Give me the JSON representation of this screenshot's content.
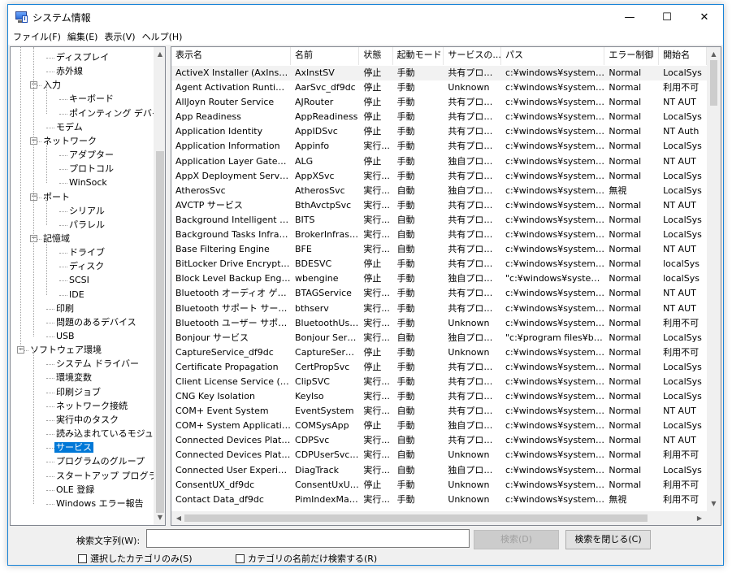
{
  "window": {
    "title": "システム情報"
  },
  "title_buttons": {
    "minimize": "—",
    "maximize": "☐",
    "close": "✕"
  },
  "menu": [
    "ファイル(F)",
    "編集(E)",
    "表示(V)",
    "ヘルプ(H)"
  ],
  "tree": [
    {
      "label": "ディスプレイ"
    },
    {
      "label": "赤外線"
    },
    {
      "label": "入力",
      "toggle": "−"
    },
    {
      "label": "キーボード"
    },
    {
      "label": "ポインティング デバイス"
    },
    {
      "label": "モデム"
    },
    {
      "label": "ネットワーク",
      "toggle": "−"
    },
    {
      "label": "アダプター"
    },
    {
      "label": "プロトコル"
    },
    {
      "label": "WinSock"
    },
    {
      "label": "ポート",
      "toggle": "−"
    },
    {
      "label": "シリアル"
    },
    {
      "label": "パラレル"
    },
    {
      "label": "記憶域",
      "toggle": "−"
    },
    {
      "label": "ドライブ"
    },
    {
      "label": "ディスク"
    },
    {
      "label": "SCSI"
    },
    {
      "label": "IDE"
    },
    {
      "label": "印刷"
    },
    {
      "label": "問題のあるデバイス"
    },
    {
      "label": "USB"
    },
    {
      "label": "ソフトウェア環境",
      "toggle": "−"
    },
    {
      "label": "システム ドライバー"
    },
    {
      "label": "環境変数"
    },
    {
      "label": "印刷ジョブ"
    },
    {
      "label": "ネットワーク接続"
    },
    {
      "label": "実行中のタスク"
    },
    {
      "label": "読み込まれているモジュール"
    },
    {
      "label": "サービス",
      "selected": true
    },
    {
      "label": "プログラムのグループ"
    },
    {
      "label": "スタートアップ プログラム"
    },
    {
      "label": "OLE 登録"
    },
    {
      "label": "Windows エラー報告"
    }
  ],
  "table": {
    "columns": [
      "表示名",
      "名前",
      "状態",
      "起動モード",
      "サービスの...",
      "パス",
      "エラー制御",
      "開始名"
    ],
    "rows": [
      [
        "ActiveX Installer (AxInstSV)",
        "AxInstSV",
        "停止",
        "手動",
        "共有プロセス",
        "c:¥windows¥system32...",
        "Normal",
        "LocalSys"
      ],
      [
        "Agent Activation Runtime_d...",
        "AarSvc_df9dc",
        "停止",
        "手動",
        "Unknown",
        "c:¥windows¥system32...",
        "Normal",
        "利用不可"
      ],
      [
        "AllJoyn Router Service",
        "AJRouter",
        "停止",
        "手動",
        "共有プロセス",
        "c:¥windows¥system32...",
        "Normal",
        "NT AUT"
      ],
      [
        "App Readiness",
        "AppReadiness",
        "停止",
        "手動",
        "共有プロセス",
        "c:¥windows¥system32...",
        "Normal",
        "LocalSys"
      ],
      [
        "Application Identity",
        "AppIDSvc",
        "停止",
        "手動",
        "共有プロセス",
        "c:¥windows¥system32...",
        "Normal",
        "NT Auth"
      ],
      [
        "Application Information",
        "Appinfo",
        "実行...",
        "手動",
        "共有プロセス",
        "c:¥windows¥system32...",
        "Normal",
        "LocalSys"
      ],
      [
        "Application Layer Gateway ...",
        "ALG",
        "停止",
        "手動",
        "独自プロセス",
        "c:¥windows¥system32...",
        "Normal",
        "NT AUT"
      ],
      [
        "AppX Deployment Service (...",
        "AppXSvc",
        "実行...",
        "手動",
        "共有プロセス",
        "c:¥windows¥system32...",
        "Normal",
        "LocalSys"
      ],
      [
        "AtherosSvc",
        "AtherosSvc",
        "実行...",
        "自動",
        "独自プロセス",
        "c:¥windows¥system32...",
        "無視",
        "LocalSys"
      ],
      [
        "AVCTP サービス",
        "BthAvctpSvc",
        "実行...",
        "手動",
        "共有プロセス",
        "c:¥windows¥system32...",
        "Normal",
        "NT AUT"
      ],
      [
        "Background Intelligent Tran...",
        "BITS",
        "実行...",
        "自動",
        "共有プロセス",
        "c:¥windows¥system32...",
        "Normal",
        "LocalSys"
      ],
      [
        "Background Tasks Infrastru...",
        "BrokerInfrastr...",
        "実行...",
        "自動",
        "共有プロセス",
        "c:¥windows¥system32...",
        "Normal",
        "LocalSys"
      ],
      [
        "Base Filtering Engine",
        "BFE",
        "実行...",
        "自動",
        "共有プロセス",
        "c:¥windows¥system32...",
        "Normal",
        "NT AUT"
      ],
      [
        "BitLocker Drive Encryption ...",
        "BDESVC",
        "停止",
        "手動",
        "共有プロセス",
        "c:¥windows¥system32...",
        "Normal",
        "localSys"
      ],
      [
        "Block Level Backup Engine ...",
        "wbengine",
        "停止",
        "手動",
        "独自プロセス",
        "\"c:¥windows¥system3...",
        "Normal",
        "localSys"
      ],
      [
        "Bluetooth オーディオ ゲートウェ...",
        "BTAGService",
        "実行...",
        "手動",
        "共有プロセス",
        "c:¥windows¥system32...",
        "Normal",
        "NT AUT"
      ],
      [
        "Bluetooth サポート サービス",
        "bthserv",
        "実行...",
        "手動",
        "共有プロセス",
        "c:¥windows¥system32...",
        "Normal",
        "NT AUT"
      ],
      [
        "Bluetooth ユーザー サポート サ...",
        "BluetoothUse...",
        "実行...",
        "手動",
        "Unknown",
        "c:¥windows¥system32...",
        "Normal",
        "利用不可"
      ],
      [
        "Bonjour サービス",
        "Bonjour Servi...",
        "実行...",
        "自動",
        "独自プロセス",
        "\"c:¥program files¥bo...",
        "Normal",
        "LocalSys"
      ],
      [
        "CaptureService_df9dc",
        "CaptureServi...",
        "停止",
        "手動",
        "Unknown",
        "c:¥windows¥system32...",
        "Normal",
        "利用不可"
      ],
      [
        "Certificate Propagation",
        "CertPropSvc",
        "停止",
        "手動",
        "共有プロセス",
        "c:¥windows¥system32...",
        "Normal",
        "LocalSys"
      ],
      [
        "Client License Service (Clip...",
        "ClipSVC",
        "実行...",
        "手動",
        "共有プロセス",
        "c:¥windows¥system32...",
        "Normal",
        "LocalSys"
      ],
      [
        "CNG Key Isolation",
        "KeyIso",
        "実行...",
        "手動",
        "共有プロセス",
        "c:¥windows¥system32...",
        "Normal",
        "LocalSys"
      ],
      [
        "COM+ Event System",
        "EventSystem",
        "実行...",
        "自動",
        "共有プロセス",
        "c:¥windows¥system32...",
        "Normal",
        "NT AUT"
      ],
      [
        "COM+ System Application",
        "COMSysApp",
        "停止",
        "手動",
        "独自プロセス",
        "c:¥windows¥system32...",
        "Normal",
        "LocalSys"
      ],
      [
        "Connected Devices Platfor...",
        "CDPSvc",
        "実行...",
        "自動",
        "共有プロセス",
        "c:¥windows¥system32...",
        "Normal",
        "NT AUT"
      ],
      [
        "Connected Devices Platfor...",
        "CDPUserSvc_...",
        "実行...",
        "自動",
        "Unknown",
        "c:¥windows¥system32...",
        "Normal",
        "利用不可"
      ],
      [
        "Connected User Experienc...",
        "DiagTrack",
        "実行...",
        "自動",
        "独自プロセス",
        "c:¥windows¥system32...",
        "Normal",
        "LocalSys"
      ],
      [
        "ConsentUX_df9dc",
        "ConsentUxUs...",
        "停止",
        "手動",
        "Unknown",
        "c:¥windows¥system32...",
        "Normal",
        "利用不可"
      ],
      [
        "Contact Data_df9dc",
        "PimIndexMai...",
        "実行...",
        "手動",
        "Unknown",
        "c:¥windows¥system32...",
        "無視",
        "利用不可"
      ]
    ]
  },
  "search": {
    "label": "検索文字列(W):",
    "value": "",
    "search_button": "検索(D)",
    "close_button": "検索を閉じる(C)",
    "checkbox_selected_category": "選択したカテゴリのみ(S)",
    "checkbox_category_names": "カテゴリの名前だけ検索する(R)"
  },
  "icons": {
    "scroll_up": "▲",
    "scroll_down": "▼",
    "scroll_left": "◀",
    "scroll_right": "▶"
  }
}
